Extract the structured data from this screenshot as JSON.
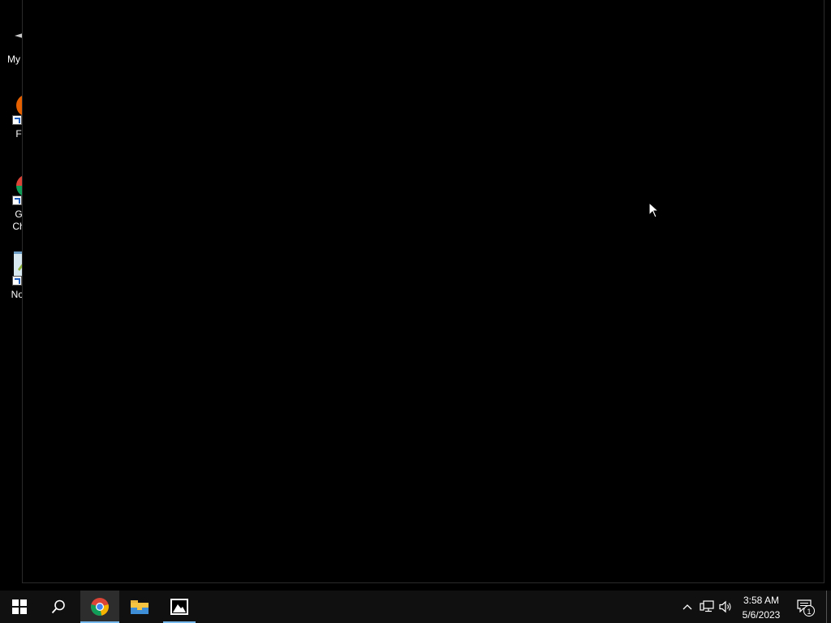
{
  "desktop": {
    "icons": [
      {
        "label": "My C",
        "icon": "computer-icon"
      },
      {
        "label": "F",
        "icon": "firefox-icon"
      },
      {
        "label": "G\nCh",
        "icon": "chrome-icon"
      },
      {
        "label": "Not",
        "icon": "notepad-icon"
      }
    ]
  },
  "taskbar": {
    "start": {
      "icon": "windows-start-icon"
    },
    "search": {
      "icon": "search-icon"
    },
    "apps": [
      {
        "name": "Google Chrome",
        "icon": "chrome-icon",
        "active": true
      },
      {
        "name": "File Explorer",
        "icon": "folder-icon",
        "active": false
      },
      {
        "name": "Photos",
        "icon": "photos-icon",
        "active": false
      }
    ],
    "tray": {
      "icons": [
        "chevron-up-icon",
        "network-icon",
        "volume-icon"
      ],
      "time": "3:58 AM",
      "date": "5/6/2023",
      "notifications": "1"
    }
  },
  "colors": {
    "desktop_bg": "#000000",
    "taskbar_bg": "#101010",
    "accent": "#76b9ed"
  }
}
